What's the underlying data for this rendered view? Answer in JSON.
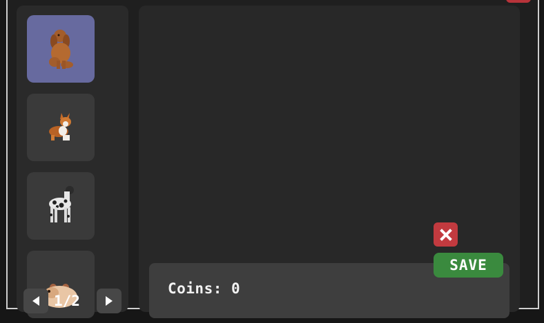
{
  "pets": [
    {
      "name": "cocker-spaniel",
      "selected": true
    },
    {
      "name": "corgi",
      "selected": false
    },
    {
      "name": "great-dane",
      "selected": false
    },
    {
      "name": "hamster",
      "selected": false
    }
  ],
  "coins": {
    "label": "Coins: 0"
  },
  "actions": {
    "save_label": "SAVE",
    "close_icon": "close-icon"
  },
  "pager": {
    "label": "1/2",
    "prev_icon": "triangle-left-icon",
    "next_icon": "triangle-right-icon"
  },
  "colors": {
    "selected_card": "#676a9f",
    "card": "#3a3a3a",
    "close": "#c23a3f",
    "save": "#3a8a3e"
  }
}
